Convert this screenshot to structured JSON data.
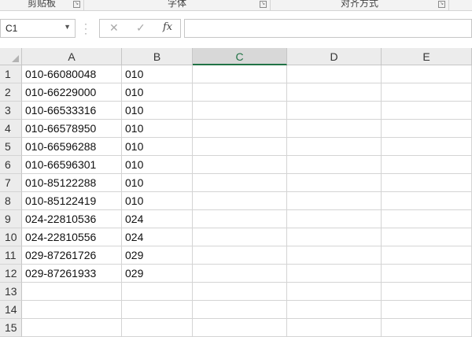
{
  "ribbon": {
    "groups": [
      {
        "label": "剪贴板"
      },
      {
        "label": "字体"
      },
      {
        "label": "对齐方式"
      }
    ]
  },
  "formula_bar": {
    "name_box": "C1",
    "cancel_icon": "✕",
    "enter_icon": "✓",
    "fx_label": "fx",
    "formula": ""
  },
  "sheet": {
    "columns": [
      "A",
      "B",
      "C",
      "D",
      "E"
    ],
    "selected_column": "C",
    "rows": [
      {
        "n": "1",
        "A": "010-66080048",
        "B": "010"
      },
      {
        "n": "2",
        "A": "010-66229000",
        "B": "010"
      },
      {
        "n": "3",
        "A": "010-66533316",
        "B": "010"
      },
      {
        "n": "4",
        "A": "010-66578950",
        "B": "010"
      },
      {
        "n": "5",
        "A": "010-66596288",
        "B": "010"
      },
      {
        "n": "6",
        "A": "010-66596301",
        "B": "010"
      },
      {
        "n": "7",
        "A": "010-85122288",
        "B": "010"
      },
      {
        "n": "8",
        "A": "010-85122419",
        "B": "010"
      },
      {
        "n": "9",
        "A": "024-22810536",
        "B": "024"
      },
      {
        "n": "10",
        "A": "024-22810556",
        "B": "024"
      },
      {
        "n": "11",
        "A": "029-87261726",
        "B": "029"
      },
      {
        "n": "12",
        "A": "029-87261933",
        "B": "029"
      },
      {
        "n": "13",
        "A": "",
        "B": ""
      },
      {
        "n": "14",
        "A": "",
        "B": ""
      },
      {
        "n": "15",
        "A": "",
        "B": ""
      }
    ]
  }
}
